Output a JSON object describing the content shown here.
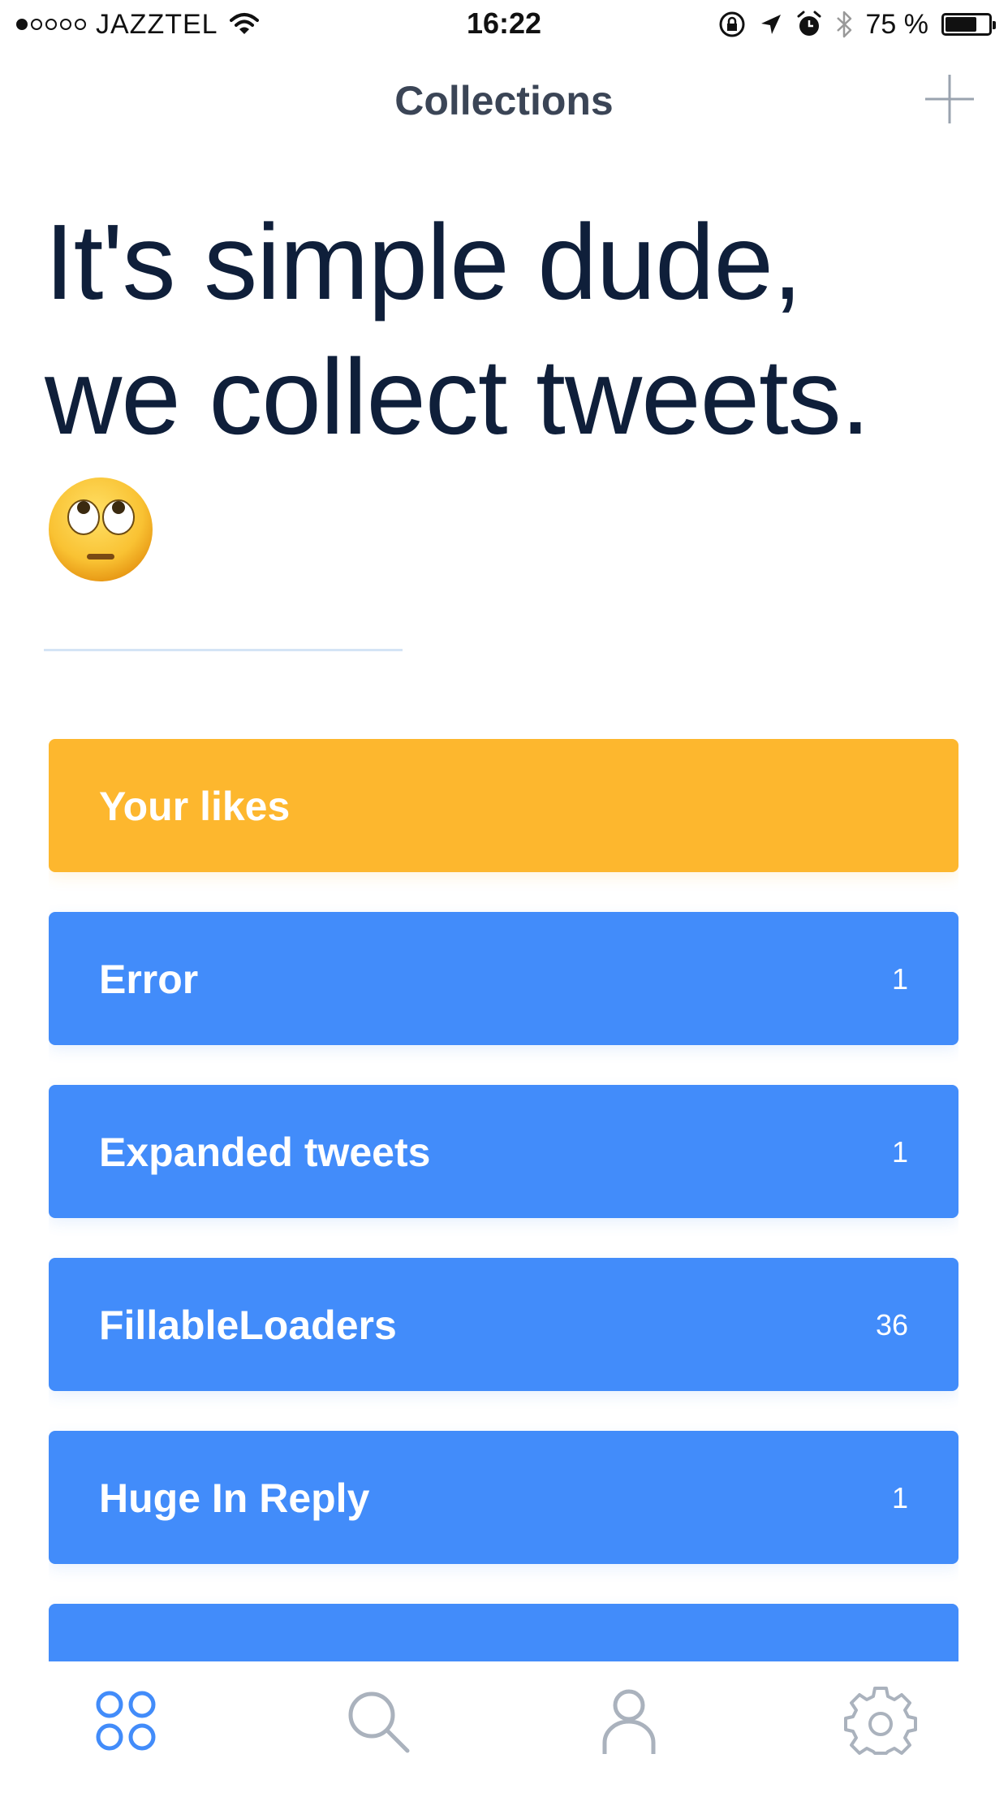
{
  "status_bar": {
    "carrier": "JAZZTEL",
    "time": "16:22",
    "battery": "75 %",
    "battery_level": 0.75,
    "signal_bars_filled": 1,
    "signal_bars_total": 5
  },
  "nav": {
    "title": "Collections",
    "add_icon": "plus-icon"
  },
  "headline": {
    "line1": "It's simple dude,",
    "line2": "we collect tweets.",
    "emoji": "face-with-rolling-eyes"
  },
  "collections": [
    {
      "name": "Your likes",
      "count": "",
      "color": "#fdb72e"
    },
    {
      "name": "Error",
      "count": "1",
      "color": "#428cfa"
    },
    {
      "name": "Expanded tweets",
      "count": "1",
      "color": "#428cfa"
    },
    {
      "name": "FillableLoaders",
      "count": "36",
      "color": "#428cfa"
    },
    {
      "name": "Huge In Reply",
      "count": "1",
      "color": "#428cfa"
    },
    {
      "name": "",
      "count": "",
      "color": "#428cfa"
    }
  ],
  "tabs": [
    {
      "name": "collections",
      "icon": "grid-circles-icon",
      "active": true
    },
    {
      "name": "search",
      "icon": "search-icon",
      "active": false
    },
    {
      "name": "profile",
      "icon": "person-icon",
      "active": false
    },
    {
      "name": "settings",
      "icon": "gear-icon",
      "active": false
    }
  ],
  "colors": {
    "accent_blue": "#428cfa",
    "accent_yellow": "#fdb72e",
    "headline": "#0f1f3a",
    "nav_title": "#3b4556",
    "inactive_icon": "#aab2bd"
  }
}
